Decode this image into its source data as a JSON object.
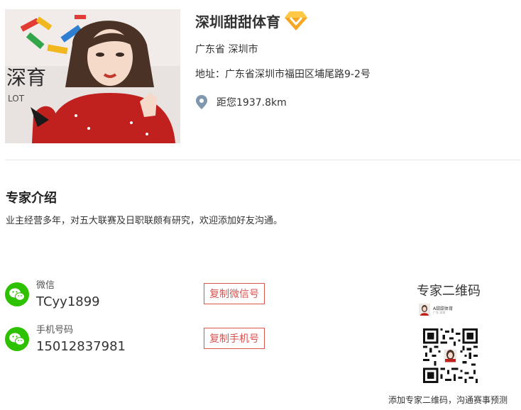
{
  "shop": {
    "name": "深圳甜甜体育",
    "region": "广东省 深圳市",
    "address": "地址：广东省深圳市福田区埔尾路9-2号",
    "distance": "距您1937.8km"
  },
  "intro": {
    "title": "专家介绍",
    "text": "业主经营多年，对五大联赛及日职联颇有研究，欢迎添加好友沟通。"
  },
  "contacts": {
    "wechat": {
      "label": "微信",
      "value": "TCyy1899",
      "button": "复制微信号"
    },
    "phone": {
      "label": "手机号码",
      "value": "15012837981",
      "button": "复制手机号"
    }
  },
  "qr": {
    "title": "专家二维码",
    "card_name": "A甜甜体育",
    "card_sub": "广东 深圳",
    "caption": "添加专家二维码，沟通赛事预测"
  },
  "colors": {
    "accent_red": "#d9534f",
    "wechat_green": "#2dc100",
    "pin_gray": "#7f98b0",
    "badge_gold": "#f5a623"
  },
  "icons": {
    "badge": "diamond-icon",
    "location": "location-pin-icon",
    "wechat": "wechat-icon"
  }
}
